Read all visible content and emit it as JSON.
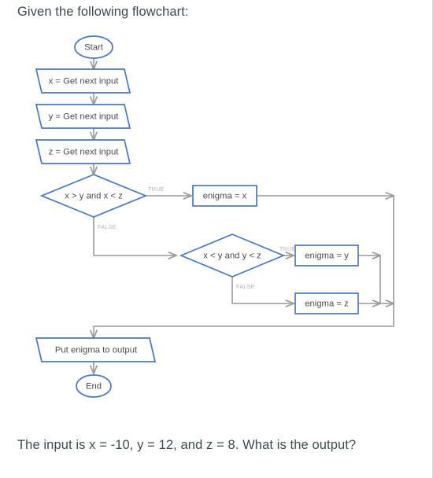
{
  "question": {
    "intro": "Given the following flowchart:",
    "body": "The input is x = -10, y = 12, and z = 8. What is the output?"
  },
  "colors": {
    "node_border": "#4a76c8",
    "node_fill": "#ffffff",
    "connector": "#9a9a9a",
    "node_text": "#4a4a4a",
    "branch_text": "#b3b3b3",
    "prompt_text": "#3c4a52"
  },
  "flowchart": {
    "start_label": "Start",
    "end_label": "End",
    "inputs": [
      {
        "label": "x = Get next input"
      },
      {
        "label": "y = Get next input"
      },
      {
        "label": "z = Get next input"
      }
    ],
    "decisions": [
      {
        "label": "x > y and x < z",
        "true_label": "TRUE",
        "false_label": "FALSE"
      },
      {
        "label": "x < y and y < z",
        "true_label": "TRUE",
        "false_label": "FALSE"
      }
    ],
    "assignments": [
      {
        "label": "enigma = x"
      },
      {
        "label": "enigma = y"
      },
      {
        "label": "enigma = z"
      }
    ],
    "output_label": "Put enigma to output"
  }
}
